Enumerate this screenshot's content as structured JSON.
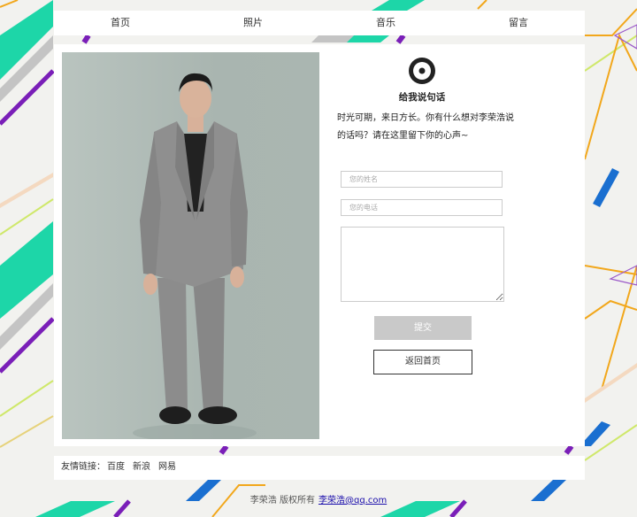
{
  "nav": {
    "items": [
      "首页",
      "照片",
      "音乐",
      "留言"
    ]
  },
  "contact": {
    "title": "给我说句话",
    "intro_line1": "时光可期，来日方长。你有什么想对李荣浩说",
    "intro_line2": "的话吗？请在这里留下你的心声~",
    "name_placeholder": "您的姓名",
    "phone_placeholder": "您的电话",
    "submit_label": "提交",
    "back_label": "返回首页"
  },
  "friend_links": {
    "label": "友情链接：",
    "items": [
      "百度",
      "新浪",
      "网易"
    ]
  },
  "footer": {
    "copyright": "李荣浩 版权所有",
    "email": "李荣浩@qq.com"
  },
  "colors": {
    "accent_green": "#1dd6a8",
    "accent_purple": "#7a1fb8",
    "accent_blue": "#1a6fd0",
    "accent_orange": "#f2a71b",
    "submit_bg": "#c9c9c9"
  }
}
